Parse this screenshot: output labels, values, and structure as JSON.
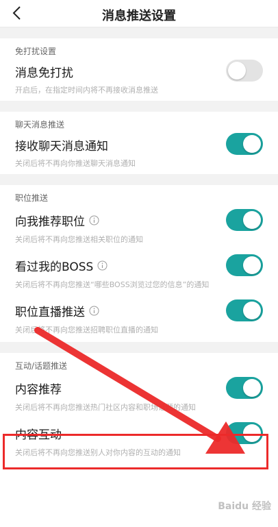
{
  "header": {
    "title": "消息推送设置"
  },
  "sections": [
    {
      "label": "免打扰设置",
      "items": [
        {
          "title": "消息免打扰",
          "desc": "开启后，在指定时间内将不再接收消息推送",
          "enabled": false,
          "info": false
        }
      ]
    },
    {
      "label": "聊天消息推送",
      "items": [
        {
          "title": "接收聊天消息通知",
          "desc": "关闭后将不再向你推送聊天消息通知",
          "enabled": true,
          "info": false
        }
      ]
    },
    {
      "label": "职位推送",
      "items": [
        {
          "title": "向我推荐职位",
          "desc": "关闭后将不再向您推送相关职位的通知",
          "enabled": true,
          "info": true
        },
        {
          "title": "看过我的BOSS",
          "desc": "关闭后将不再向您推送“哪些BOSS浏览过您的信息”的通知",
          "enabled": true,
          "info": true
        },
        {
          "title": "职位直播推送",
          "desc": "关闭后将不再向您推送招聘职位直播的通知",
          "enabled": true,
          "info": true
        }
      ]
    },
    {
      "label": "互动/话题推送",
      "items": [
        {
          "title": "内容推荐",
          "desc": "关闭后将不再向您推送热门社区内容和职场话题的通知",
          "enabled": true,
          "info": false
        },
        {
          "title": "内容互动",
          "desc": "关闭后将不再向您推送别人对你内容的互动的通知",
          "enabled": true,
          "info": false
        }
      ]
    }
  ],
  "watermark": "Baidu 经验",
  "colors": {
    "toggle_on": "#1aa39f",
    "toggle_off": "#e3e3e3",
    "annotation": "#ec2a2a"
  }
}
